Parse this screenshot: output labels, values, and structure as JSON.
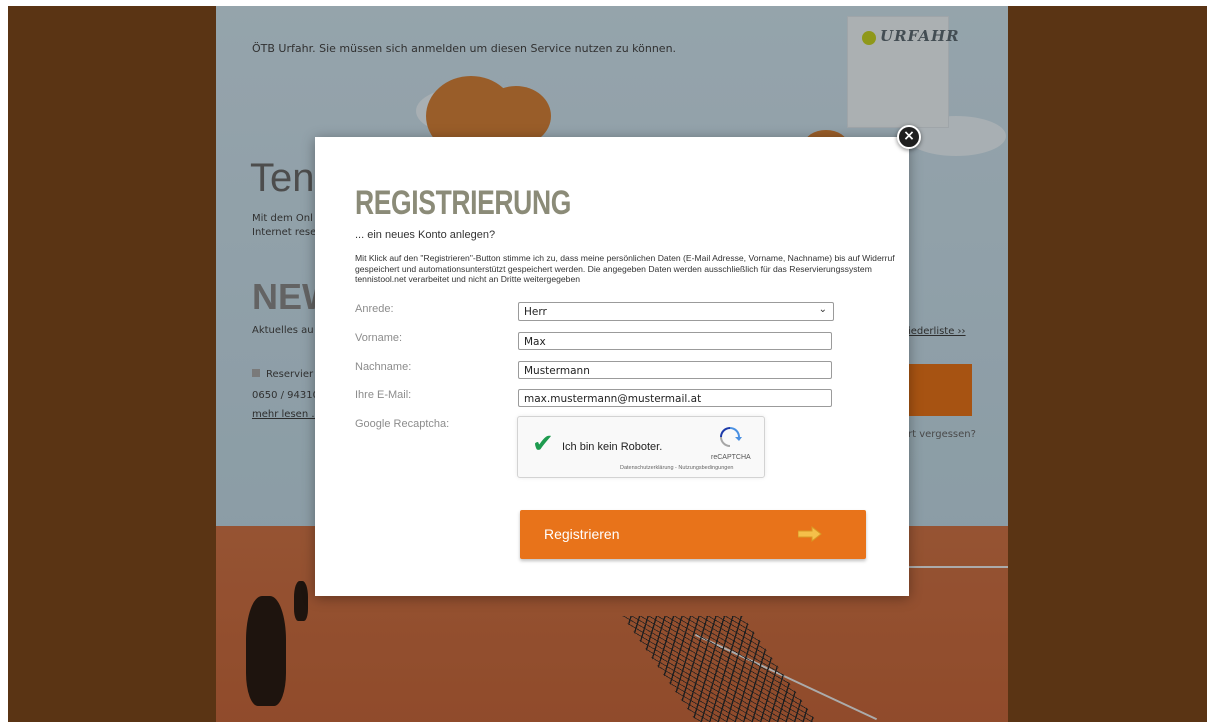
{
  "background_page": {
    "intro_text": "ÖTB Urfahr. Sie müssen sich anmelden um diesen Service nutzen zu können.",
    "logo_text": "URFAHR",
    "title_fragment": "Tenn",
    "desc_line1": "Mit dem Onl",
    "desc_line2": "Internet rese",
    "news_fragment": "NEWS",
    "news_sub": "Aktuelles au",
    "news_item": "Reservier",
    "news_phone": "0650 / 94310",
    "more_link": "mehr lesen ...",
    "member_list_link": "iederliste ››",
    "password_forgot": "rt vergessen?"
  },
  "modal": {
    "title": "REGISTRIERUNG",
    "subtitle": "... ein neues Konto anlegen?",
    "consent": "Mit Klick auf den \"Registrieren\"-Button stimme ich zu, dass meine persönlichen Daten (E-Mail Adresse, Vorname, Nachname) bis auf Widerruf gespeichert und automationsunterstützt gespeichert werden. Die angegeben Daten werden ausschließlich für das Reservierungssystem tennistool.net verarbeitet und nicht an Dritte weitergegeben",
    "close_label": "×",
    "fields": {
      "anrede_label": "Anrede:",
      "anrede_value": "Herr",
      "vorname_label": "Vorname:",
      "vorname_value": "Max",
      "nachname_label": "Nachname:",
      "nachname_value": "Mustermann",
      "email_label": "Ihre E-Mail:",
      "email_value": "max.mustermann@mustermail.at",
      "captcha_label": "Google Recaptcha:"
    },
    "captcha": {
      "text": "Ich bin kein Roboter.",
      "brand": "reCAPTCHA",
      "links": "Datenschutzerklärung - Nutzungsbedingungen",
      "checked": true
    },
    "register_button": "Registrieren"
  },
  "colors": {
    "accent_orange": "#e8731a",
    "outer_brown": "#5a3414",
    "title_gray": "#8b8b78"
  }
}
